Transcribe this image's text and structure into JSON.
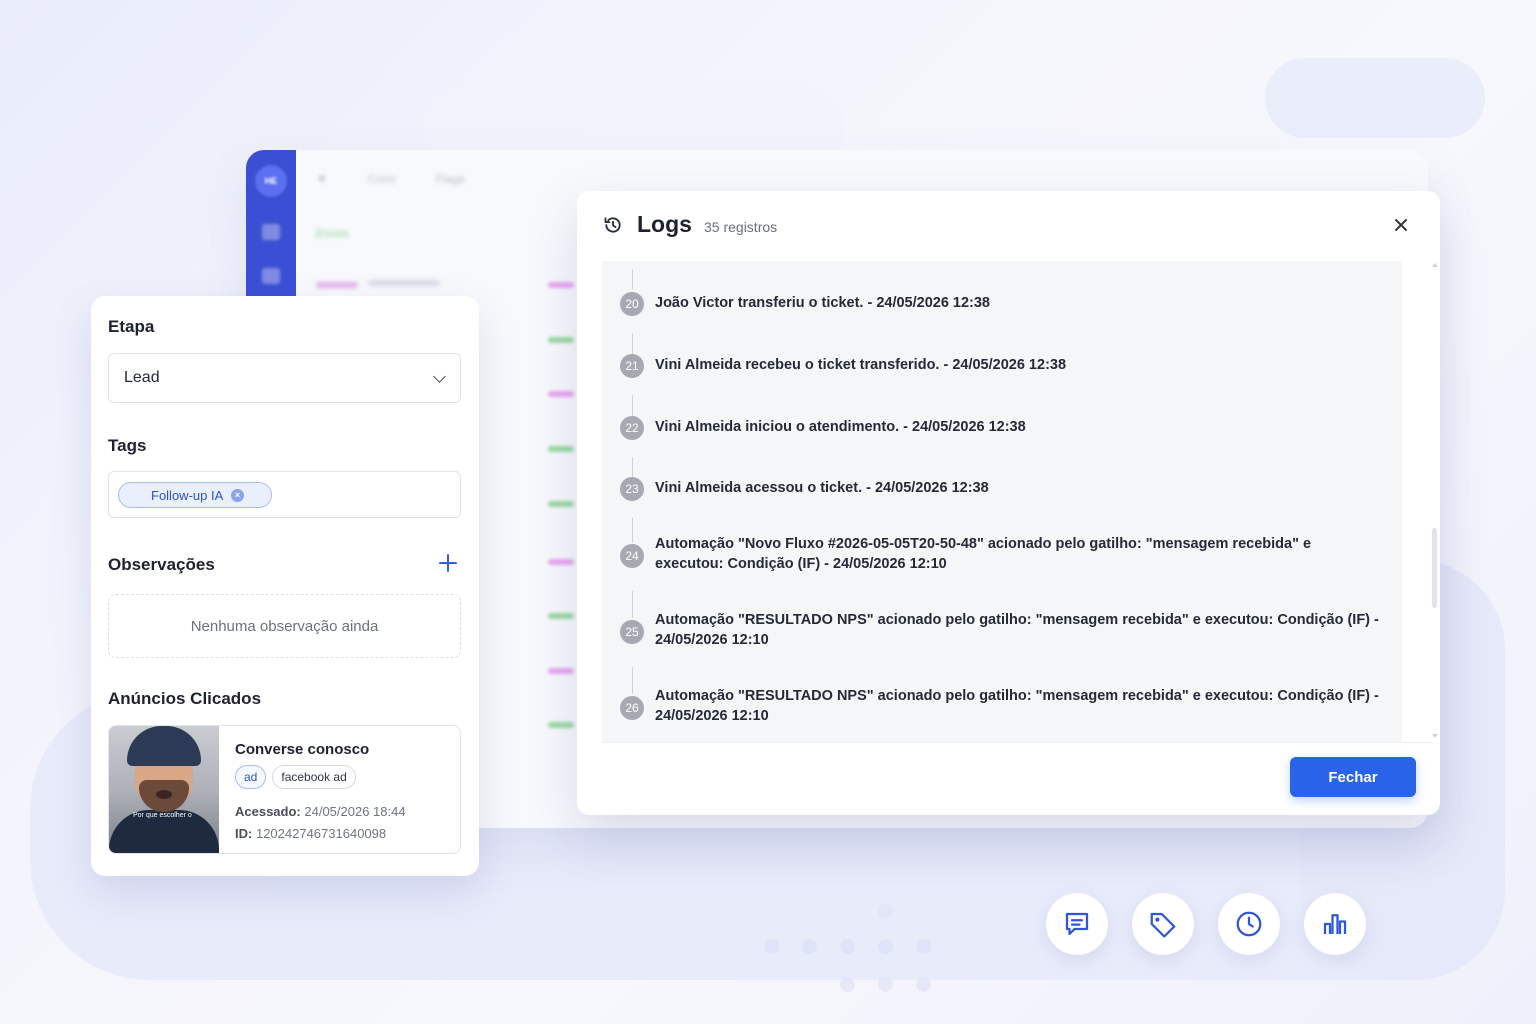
{
  "background_app": {
    "rail_logo": "HE",
    "top_items": [
      "Conv",
      "Flags"
    ],
    "section_label": "Envios",
    "colors": {
      "rail": "#3b4fd4",
      "pink": "#e08be6",
      "green": "#7fd08a"
    }
  },
  "left_panel": {
    "etapa": {
      "title": "Etapa",
      "selected": "Lead",
      "icon": "chevron-down-icon"
    },
    "tags": {
      "title": "Tags",
      "items": [
        {
          "label": "Follow-up IA",
          "remove_icon": "close-circle-icon"
        }
      ]
    },
    "observacoes": {
      "title": "Observações",
      "add_icon": "plus-icon",
      "empty_text": "Nenhuma observação ainda"
    },
    "anuncios": {
      "title": "Anúncios Clicados",
      "card": {
        "thumbnail_caption": "Por que escolher o",
        "title": "Converse conosco",
        "badges": [
          "ad",
          "facebook ad"
        ],
        "accessed_label": "Acessado:",
        "accessed_value": "24/05/2026 18:44",
        "id_label": "ID:",
        "id_value": "120242746731640098"
      }
    }
  },
  "logs_modal": {
    "icon": "history-icon",
    "title": "Logs",
    "count": "35 registros",
    "close_icon": "close-icon",
    "entries": [
      {
        "n": "20",
        "text": "João Victor transferiu o ticket. - 24/05/2026 12:38"
      },
      {
        "n": "21",
        "text": "Vini Almeida recebeu o ticket transferido. - 24/05/2026 12:38"
      },
      {
        "n": "22",
        "text": "Vini Almeida iniciou o atendimento. - 24/05/2026 12:38"
      },
      {
        "n": "23",
        "text": "Vini Almeida acessou o ticket. - 24/05/2026 12:38"
      },
      {
        "n": "24",
        "text": "Automação \"Novo Fluxo #2026-05-05T20-50-48\" acionado pelo gatilho: \"mensagem recebida\" e executou: Condição (IF) - 24/05/2026 12:10"
      },
      {
        "n": "25",
        "text": "Automação \"RESULTADO NPS\" acionado pelo gatilho: \"mensagem recebida\" e executou: Condição (IF) - 24/05/2026 12:10"
      },
      {
        "n": "26",
        "text": "Automação \"RESULTADO NPS\" acionado pelo gatilho: \"mensagem recebida\" e executou: Condição (IF) - 24/05/2026 12:10"
      }
    ],
    "close_button": "Fechar",
    "accent": "#2863e8"
  },
  "bottom_icons": [
    "chat-icon",
    "tag-icon",
    "clock-icon",
    "bar-chart-icon"
  ]
}
